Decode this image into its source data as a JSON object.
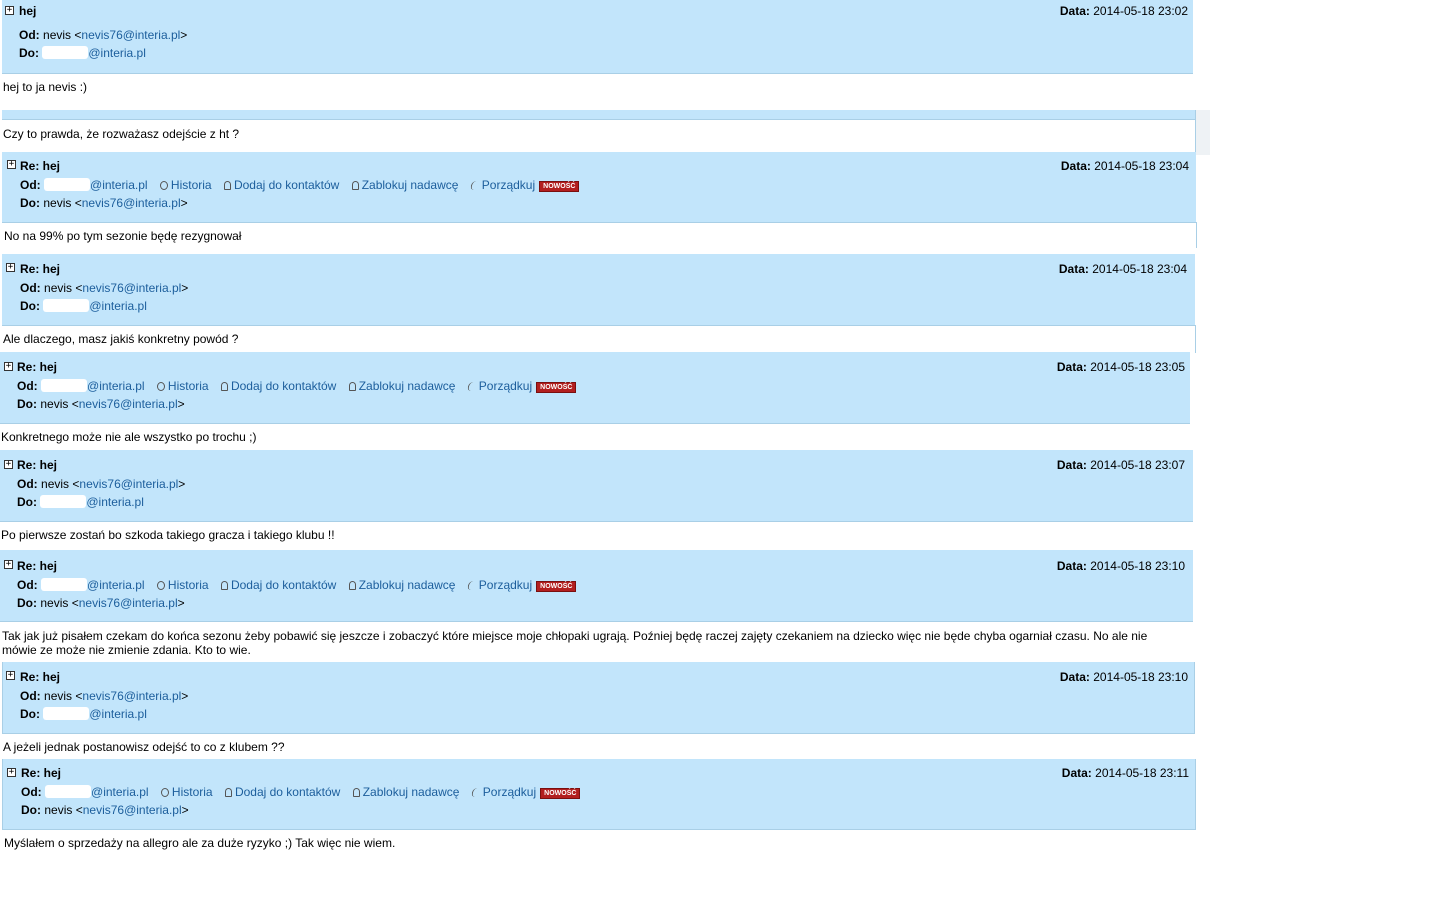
{
  "common": {
    "from_label": "Od:",
    "to_label": "Do:",
    "date_label": "Data:",
    "nevis_name": "nevis",
    "nevis_lt": "<",
    "nevis_email": "nevis76@interia.pl",
    "nevis_gt": ">",
    "redacted_domain": "@interia.pl",
    "historia": "Historia",
    "dodaj": "Dodaj do kontaktów",
    "zablokuj": "Zablokuj nadawcę",
    "porzadkuj": "Porządkuj",
    "nowosc": "NOWOŚĆ",
    "toggle": "+"
  },
  "messages": [
    {
      "subject": "hej",
      "date": "2014-05-18 23:02",
      "body": "hej to ja nevis :)"
    },
    {
      "subject": "",
      "date": "",
      "body": "Czy to prawda, że rozważasz odejście z ht ?"
    },
    {
      "subject": "Re: hej",
      "date": "2014-05-18 23:04",
      "body": "No na 99% po tym sezonie będę rezygnował"
    },
    {
      "subject": "Re: hej",
      "date": "2014-05-18 23:04",
      "body": "Ale dlaczego, masz jakiś konkretny powód ?"
    },
    {
      "subject": "Re: hej",
      "date": "2014-05-18 23:05",
      "body": "Konkretnego może nie ale wszystko po trochu ;)"
    },
    {
      "subject": "Re: hej",
      "date": "2014-05-18 23:07",
      "body": "Po pierwsze zostań bo szkoda takiego gracza i takiego klubu !!"
    },
    {
      "subject": "Re: hej",
      "date": "2014-05-18 23:10",
      "body": "Tak jak już pisałem czekam do końca sezonu żeby pobawić się jeszcze i zobaczyć które miejsce moje chłopaki ugrają. Poźniej będę raczej zajęty czekaniem na dziecko więc nie będe chyba ogarniał czasu. No ale nie mówie ze może nie zmienie zdania. Kto to wie."
    },
    {
      "subject": "Re: hej",
      "date": "2014-05-18 23:10",
      "body": "A jeżeli jednak postanowisz odejść to co z klubem ??"
    },
    {
      "subject": "Re: hej",
      "date": "2014-05-18 23:11",
      "body": "Myślałem o sprzedaży na allegro ale za duże ryzyko ;) Tak więc nie wiem."
    }
  ]
}
